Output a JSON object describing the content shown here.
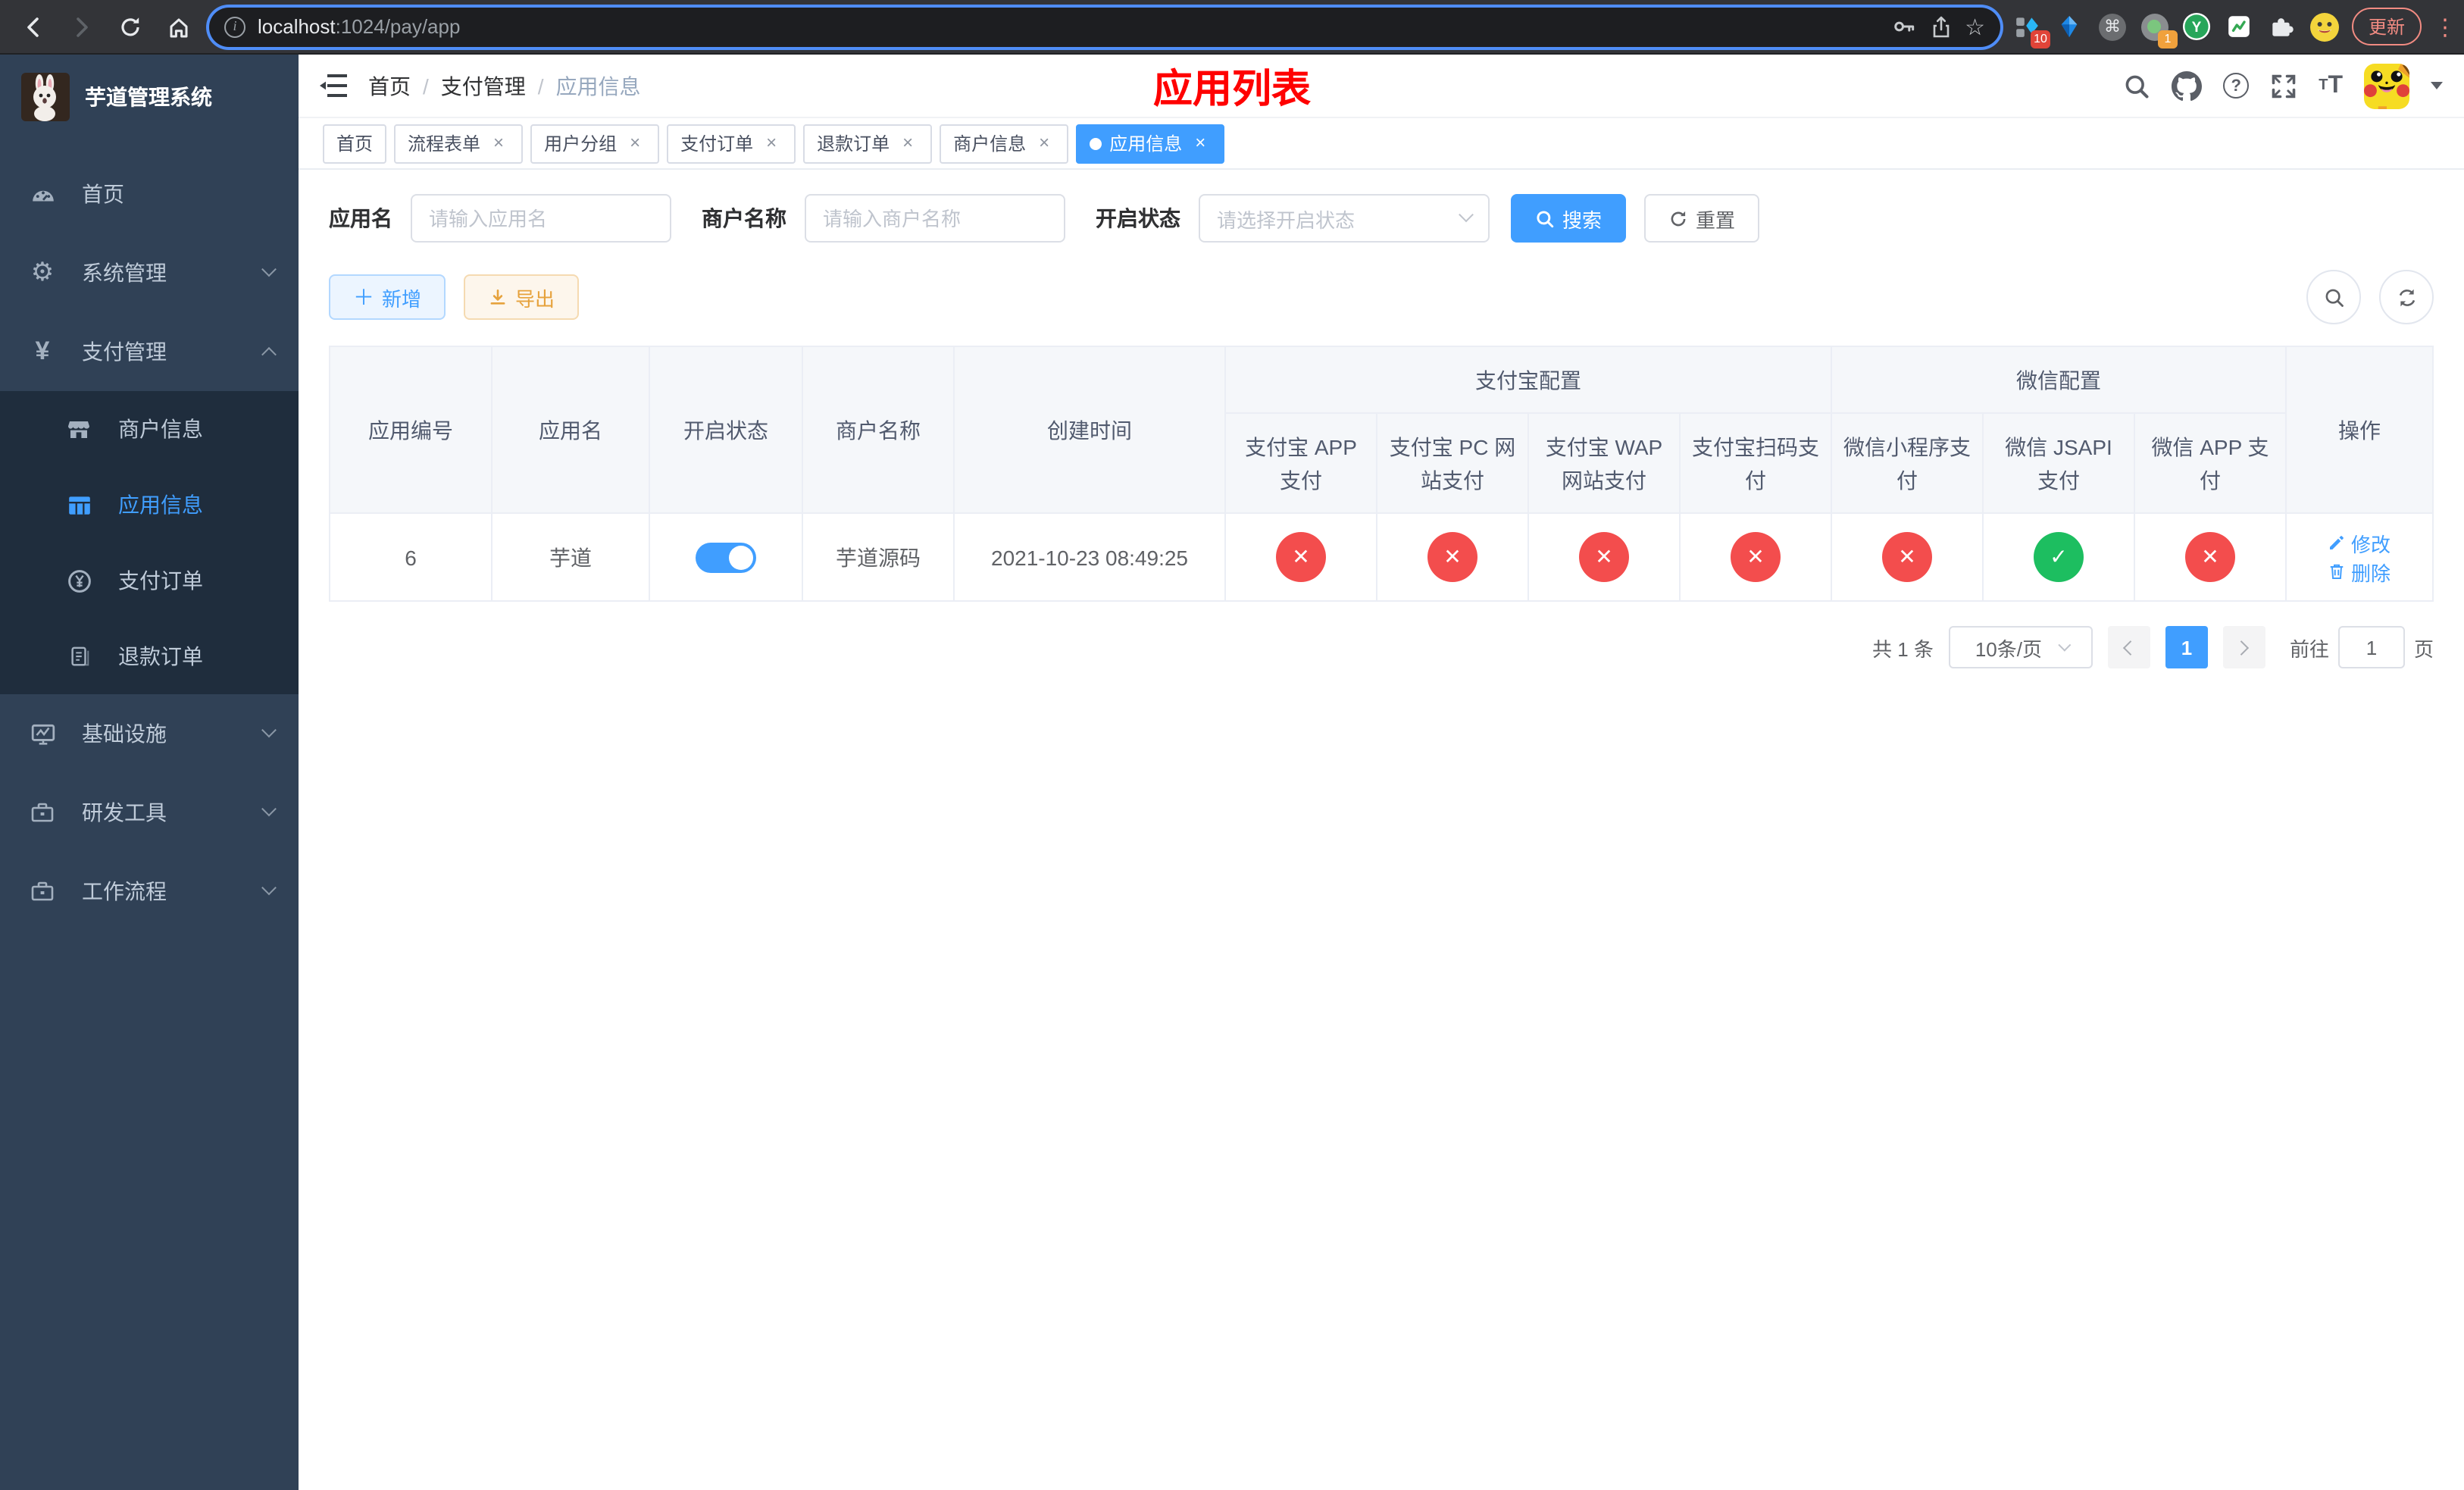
{
  "browser": {
    "url_host": "localhost",
    "url_path": ":1024/pay/app",
    "update_label": "更新",
    "ext_badge_count": "10",
    "avatar_badge_count": "1"
  },
  "sidebar": {
    "title": "芋道管理系统",
    "items": [
      {
        "label": "首页"
      },
      {
        "label": "系统管理"
      },
      {
        "label": "支付管理"
      },
      {
        "label": "商户信息"
      },
      {
        "label": "应用信息"
      },
      {
        "label": "支付订单"
      },
      {
        "label": "退款订单"
      },
      {
        "label": "基础设施"
      },
      {
        "label": "研发工具"
      },
      {
        "label": "工作流程"
      }
    ]
  },
  "header": {
    "breadcrumb": [
      "首页",
      "支付管理",
      "应用信息"
    ],
    "title": "应用列表"
  },
  "tabs": [
    {
      "label": "首页",
      "closable": false,
      "active": false
    },
    {
      "label": "流程表单",
      "closable": true,
      "active": false
    },
    {
      "label": "用户分组",
      "closable": true,
      "active": false
    },
    {
      "label": "支付订单",
      "closable": true,
      "active": false
    },
    {
      "label": "退款订单",
      "closable": true,
      "active": false
    },
    {
      "label": "商户信息",
      "closable": true,
      "active": false
    },
    {
      "label": "应用信息",
      "closable": true,
      "active": true
    }
  ],
  "filters": {
    "app_name_label": "应用名",
    "app_name_placeholder": "请输入应用名",
    "merchant_label": "商户名称",
    "merchant_placeholder": "请输入商户名称",
    "status_label": "开启状态",
    "status_placeholder": "请选择开启状态",
    "search_label": "搜索",
    "reset_label": "重置"
  },
  "toolbar": {
    "add_label": "新增",
    "export_label": "导出"
  },
  "table": {
    "columns": [
      "应用编号",
      "应用名",
      "开启状态",
      "商户名称",
      "创建时间"
    ],
    "groups": [
      "支付宝配置",
      "微信配置"
    ],
    "channel_columns": [
      "支付宝 APP 支付",
      "支付宝 PC 网站支付",
      "支付宝 WAP 网站支付",
      "支付宝扫码支付",
      "微信小程序支付",
      "微信 JSAPI 支付",
      "微信 APP 支付"
    ],
    "action_column": "操作",
    "row": {
      "id": "6",
      "name": "芋道",
      "enabled": true,
      "merchant_name": "芋道源码",
      "created_at": "2021-10-23 08:49:25",
      "channels": [
        "closed",
        "closed",
        "closed",
        "closed",
        "closed",
        "open",
        "closed"
      ],
      "edit_label": "修改",
      "delete_label": "删除"
    }
  },
  "pagination": {
    "total_label": "共 1 条",
    "page_size_label": "10条/页",
    "current_page": "1",
    "goto_label": "前往",
    "goto_value": "1",
    "page_unit": "页"
  },
  "colors": {
    "primary": "#409eff",
    "success": "#1dbe60",
    "danger": "#f34d4d",
    "warning": "#e6a23c",
    "title_red": "#ff0000",
    "sidebar_bg": "#304156",
    "submenu_bg": "#1f2d3d"
  }
}
